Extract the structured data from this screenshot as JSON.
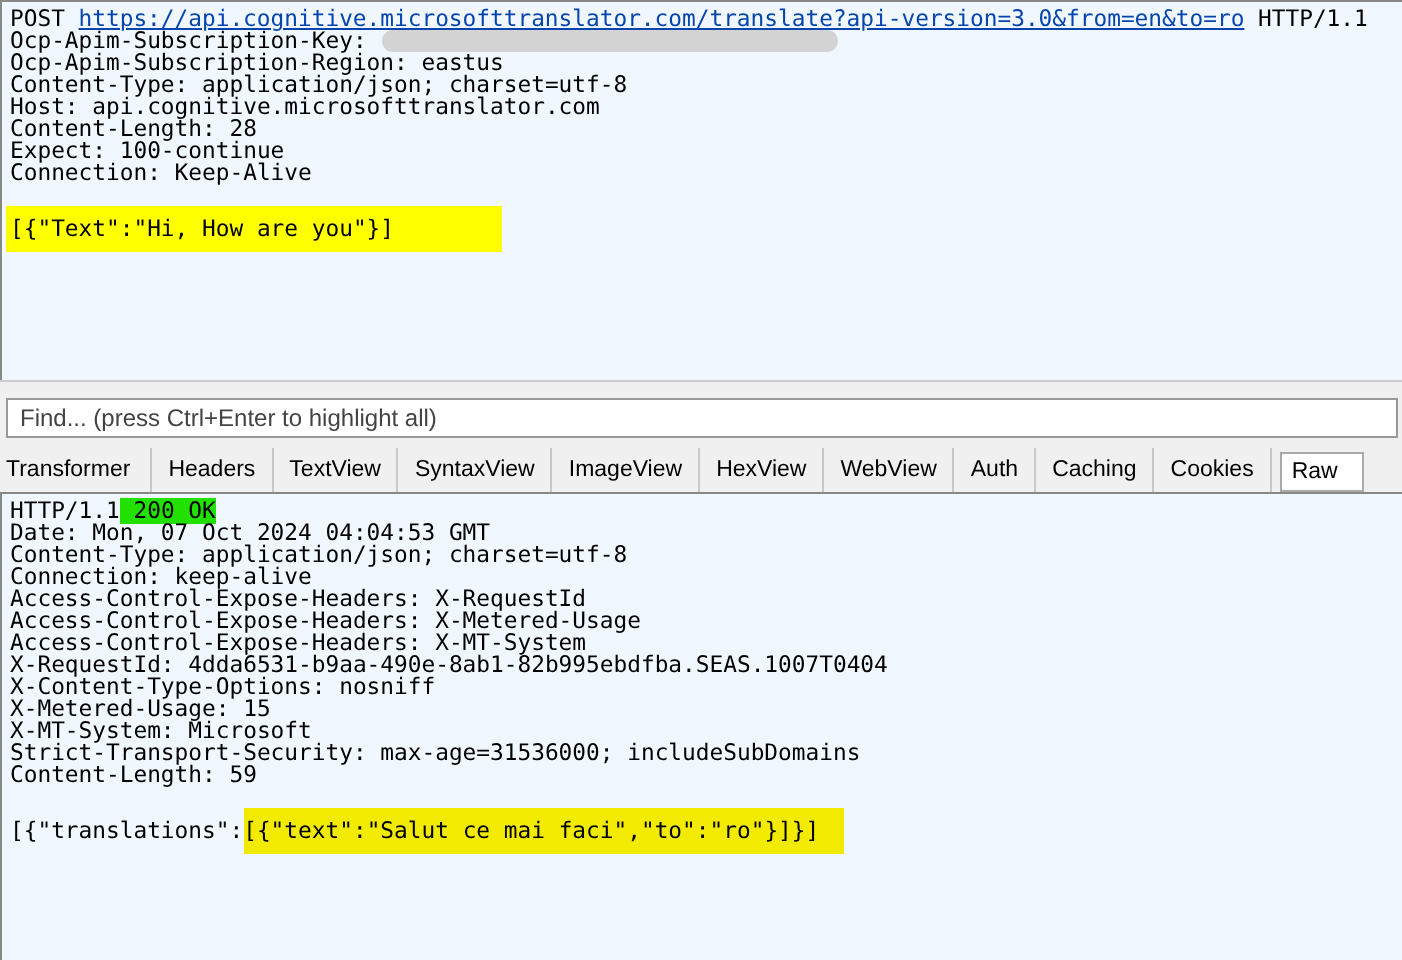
{
  "request": {
    "method": "POST",
    "url": "https://api.cognitive.microsofttranslator.com/translate?api-version=3.0&from=en&to=ro",
    "version": "HTTP/1.1",
    "headers": [
      {
        "text": "Ocp-Apim-Subscription-Key:",
        "redacted": true
      },
      {
        "text": "Ocp-Apim-Subscription-Region: eastus",
        "redacted": false
      },
      {
        "text": "Content-Type: application/json; charset=utf-8",
        "redacted": false
      },
      {
        "text": "Host: api.cognitive.microsofttranslator.com",
        "redacted": false
      },
      {
        "text": "Content-Length: 28",
        "redacted": false
      },
      {
        "text": "Expect: 100-continue",
        "redacted": false
      },
      {
        "text": "Connection: Keep-Alive",
        "redacted": false
      }
    ],
    "body": [
      {
        "text": "[{\"Text\":\"Hi, How are you\"}]",
        "color": "#ffff00"
      }
    ]
  },
  "find": {
    "placeholder": "Find... (press Ctrl+Enter to highlight all)"
  },
  "tabs": [
    {
      "label": "Transformer",
      "selected": false
    },
    {
      "label": "Headers",
      "selected": false
    },
    {
      "label": "TextView",
      "selected": false
    },
    {
      "label": "SyntaxView",
      "selected": false
    },
    {
      "label": "ImageView",
      "selected": false
    },
    {
      "label": "HexView",
      "selected": false
    },
    {
      "label": "WebView",
      "selected": false
    },
    {
      "label": "Auth",
      "selected": false
    },
    {
      "label": "Caching",
      "selected": false
    },
    {
      "label": "Cookies",
      "selected": false
    },
    {
      "label": "Raw",
      "selected": true
    }
  ],
  "response": {
    "lines": [
      [
        {
          "text": "HTTP/1.1"
        },
        {
          "text": " 200 OK",
          "color": "#22e000"
        }
      ],
      [
        {
          "text": "Date: Mon, 07 Oct 2024 04:04:53 GMT"
        }
      ],
      [
        {
          "text": "Content-Type: application/json; charset=utf-8"
        }
      ],
      [
        {
          "text": "Connection: keep-alive"
        }
      ],
      [
        {
          "text": "Access-Control-Expose-Headers: X-RequestId"
        }
      ],
      [
        {
          "text": "Access-Control-Expose-Headers: X-Metered-Usage"
        }
      ],
      [
        {
          "text": "Access-Control-Expose-Headers: X-MT-System"
        }
      ],
      [
        {
          "text": "X-RequestId: 4dda6531-b9aa-490e-8ab1-82b995ebdfba.SEAS.1007T0404"
        }
      ],
      [
        {
          "text": "X-Content-Type-Options: nosniff"
        }
      ],
      [
        {
          "text": "X-Metered-Usage: 15"
        }
      ],
      [
        {
          "text": "X-MT-System: Microsoft"
        }
      ],
      [
        {
          "text": "Strict-Transport-Security: max-age=31536000; includeSubDomains"
        }
      ],
      [
        {
          "text": "Content-Length: 59"
        }
      ]
    ],
    "body": [
      {
        "text": "[{\"translations\":"
      },
      {
        "text": "[{\"text\":\"Salut ce mai faci\",\"to\":\"ro\"}]}]",
        "color": "#f2ea00"
      }
    ]
  }
}
